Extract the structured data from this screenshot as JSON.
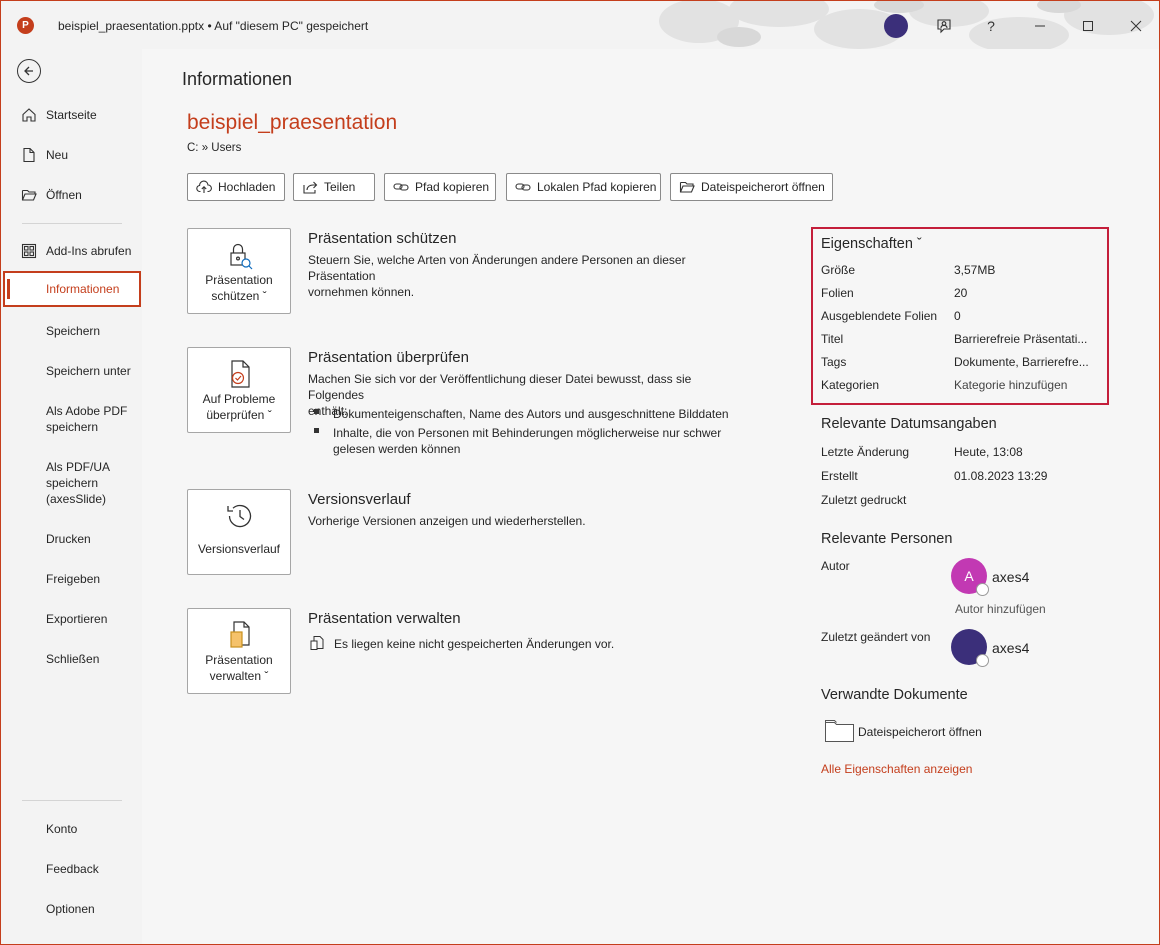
{
  "titlebar": {
    "app_icon_letter": "P",
    "title": "beispiel_praesentation.pptx  •  Auf \"diesem PC\" gespeichert",
    "buttons": [
      "coach-icon",
      "help-icon",
      "minimize-icon",
      "maximize-icon",
      "close-icon"
    ],
    "help_label": "?"
  },
  "sidebar": {
    "items": [
      {
        "label": "Startseite",
        "icon": "home-icon"
      },
      {
        "label": "Neu",
        "icon": "new-document-icon"
      },
      {
        "label": "Öffnen",
        "icon": "open-folder-icon"
      },
      {
        "label": "Add-Ins abrufen",
        "icon": "addins-grid-icon"
      },
      {
        "label": "Informationen",
        "active": true
      },
      {
        "label": "Speichern"
      },
      {
        "label": "Speichern unter"
      },
      {
        "label": "Als Adobe PDF speichern",
        "lines": [
          "Als Adobe PDF",
          "speichern"
        ]
      },
      {
        "label": "Als PDF/UA speichern (axesSlide)",
        "lines": [
          "Als PDF/UA",
          "speichern",
          "(axesSlide)"
        ]
      },
      {
        "label": "Drucken"
      },
      {
        "label": "Freigeben"
      },
      {
        "label": "Exportieren"
      },
      {
        "label": "Schließen"
      }
    ],
    "bottom_items": [
      {
        "label": "Konto"
      },
      {
        "label": "Feedback"
      },
      {
        "label": "Optionen"
      }
    ]
  },
  "main": {
    "page_title": "Informationen",
    "doc_name": "beispiel_praesentation",
    "doc_path": "C: » Users",
    "actions": [
      {
        "label": "Hochladen",
        "icon": "cloud-upload-icon"
      },
      {
        "label": "Teilen",
        "icon": "share-icon"
      },
      {
        "label": "Pfad kopieren",
        "icon": "link-icon"
      },
      {
        "label": "Lokalen Pfad kopieren",
        "icon": "link-icon"
      },
      {
        "label": "Dateispeicherort öffnen",
        "icon": "folder-open-icon"
      }
    ],
    "sections": {
      "protect": {
        "tile_lines": [
          "Präsentation",
          "schützen ˇ"
        ],
        "title": "Präsentation schützen",
        "desc_lines": [
          "Steuern Sie, welche Arten von Änderungen andere Personen an dieser Präsentation",
          "vornehmen können."
        ]
      },
      "inspect": {
        "tile_lines": [
          "Auf Probleme",
          "überprüfen ˇ"
        ],
        "title": "Präsentation überprüfen",
        "desc_lines": [
          "Machen Sie sich vor der Veröffentlichung dieser Datei bewusst, dass sie Folgendes",
          "enthält:"
        ],
        "bullets": [
          {
            "lines": [
              "Dokumenteigenschaften, Name des Autors und ausgeschnittene Bilddaten"
            ]
          },
          {
            "lines": [
              "Inhalte, die von Personen mit Behinderungen möglicherweise nur schwer",
              "gelesen werden können"
            ]
          }
        ]
      },
      "versions": {
        "tile_lines": [
          "Versionsverlauf"
        ],
        "title": "Versionsverlauf",
        "desc": "Vorherige Versionen anzeigen und wiederherstellen."
      },
      "manage": {
        "tile_lines": [
          "Präsentation",
          "verwalten ˇ"
        ],
        "title": "Präsentation verwalten",
        "desc": "Es liegen keine nicht gespeicherten Änderungen vor."
      }
    }
  },
  "properties": {
    "header": "Eigenschaften ˇ",
    "rows": [
      {
        "key": "Größe",
        "value": "3,57MB"
      },
      {
        "key": "Folien",
        "value": "20"
      },
      {
        "key": "Ausgeblendete Folien",
        "value": "0"
      },
      {
        "key": "Titel",
        "value": "Barrierefreie Präsentati..."
      },
      {
        "key": "Tags",
        "value": "Dokumente, Barrierefre..."
      },
      {
        "key": "Kategorien",
        "value": "Kategorie hinzufügen"
      }
    ],
    "dates_header": "Relevante Datumsangaben",
    "dates": [
      {
        "key": "Letzte Änderung",
        "value": "Heute, 13:08"
      },
      {
        "key": "Erstellt",
        "value": "01.08.2023 13:29"
      },
      {
        "key": "Zuletzt gedruckt",
        "value": ""
      }
    ],
    "people_header": "Relevante Personen",
    "author_key": "Autor",
    "author_initial": "A",
    "author_name": "axes4",
    "add_author": "Autor hinzufügen",
    "modified_by_key": "Zuletzt geändert von",
    "modified_by_name": "axes4",
    "related_header": "Verwandte Dokumente",
    "open_location": "Dateispeicherort öffnen",
    "show_all": "Alle Eigenschaften anzeigen",
    "colors": {
      "accent": "#c43e1c",
      "author_avatar": "#c239b3",
      "modifier_avatar": "#3b2f7a",
      "highlight": "#c41e3a"
    }
  }
}
